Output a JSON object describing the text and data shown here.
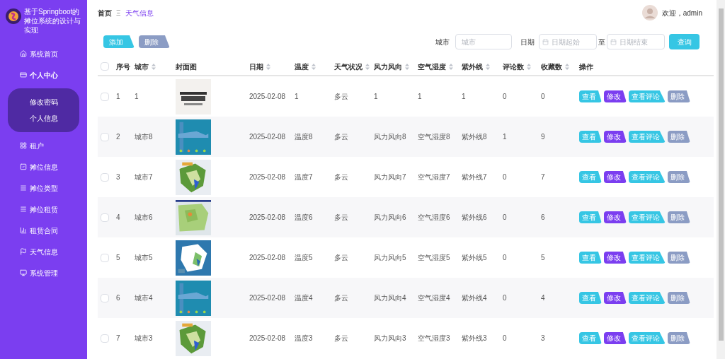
{
  "sidebar": {
    "title": "基于Springboot的摊位系统的设计与实现",
    "items": [
      {
        "label": "系统首页",
        "expanded": false
      },
      {
        "label": "个人中心",
        "expanded": true,
        "children": [
          {
            "label": "修改密码"
          },
          {
            "label": "个人信息"
          }
        ]
      },
      {
        "label": "租户",
        "expanded": false
      },
      {
        "label": "摊位信息",
        "expanded": false
      },
      {
        "label": "摊位类型",
        "expanded": false
      },
      {
        "label": "摊位租赁",
        "expanded": false
      },
      {
        "label": "租赁合同",
        "expanded": false
      },
      {
        "label": "天气信息",
        "expanded": false
      },
      {
        "label": "系统管理",
        "expanded": false
      }
    ]
  },
  "breadcrumb": {
    "home": "首页",
    "separator": "Ξ",
    "current": "天气信息"
  },
  "user": {
    "greeting": "欢迎，admin"
  },
  "toolbar": {
    "add": "添加",
    "delete": "删除"
  },
  "search": {
    "city_label": "城市",
    "city_placeholder": "城市",
    "date_label": "日期",
    "date_start_placeholder": "日期起始",
    "to": "至",
    "date_end_placeholder": "日期结束",
    "button": "查询"
  },
  "table": {
    "select_all_checked": false,
    "columns": [
      {
        "label": "序号",
        "sortable": false
      },
      {
        "label": "城市",
        "sortable": true
      },
      {
        "label": "封面图",
        "sortable": false
      },
      {
        "label": "日期",
        "sortable": true
      },
      {
        "label": "温度",
        "sortable": true
      },
      {
        "label": "天气状况",
        "sortable": true
      },
      {
        "label": "风力风向",
        "sortable": true
      },
      {
        "label": "空气湿度",
        "sortable": true
      },
      {
        "label": "紫外线",
        "sortable": true
      },
      {
        "label": "评论数",
        "sortable": true
      },
      {
        "label": "收藏数",
        "sortable": true
      },
      {
        "label": "操作",
        "sortable": false
      }
    ],
    "rows": [
      {
        "checked": false,
        "cells": [
          "1",
          "1",
          {
            "kind": "picture"
          },
          "2025-02-08",
          "1",
          "多云",
          "1",
          "1",
          "1",
          "0",
          "0"
        ],
        "actions": [
          "查看",
          "修改",
          "查看评论",
          "删除"
        ]
      },
      {
        "checked": false,
        "cells": [
          "2",
          "城市8",
          {
            "kind": "picture"
          },
          "2025-02-08",
          "温度8",
          "多云",
          "风力风向8",
          "空气湿度8",
          "紫外线8",
          "1",
          "9"
        ],
        "actions": [
          "查看",
          "修改",
          "查看评论",
          "删除"
        ]
      },
      {
        "checked": false,
        "cells": [
          "3",
          "城市7",
          {
            "kind": "picture"
          },
          "2025-02-08",
          "温度7",
          "多云",
          "风力风向7",
          "空气湿度7",
          "紫外线7",
          "0",
          "7"
        ],
        "actions": [
          "查看",
          "修改",
          "查看评论",
          "删除"
        ]
      },
      {
        "checked": false,
        "cells": [
          "4",
          "城市6",
          {
            "kind": "picture"
          },
          "2025-02-08",
          "温度6",
          "多云",
          "风力风向6",
          "空气湿度6",
          "紫外线6",
          "0",
          "6"
        ],
        "actions": [
          "查看",
          "修改",
          "查看评论",
          "删除"
        ]
      },
      {
        "checked": false,
        "cells": [
          "5",
          "城市5",
          {
            "kind": "picture"
          },
          "2025-02-08",
          "温度5",
          "多云",
          "风力风向5",
          "空气湿度5",
          "紫外线5",
          "0",
          "5"
        ],
        "actions": [
          "查看",
          "修改",
          "查看评论",
          "删除"
        ]
      },
      {
        "checked": false,
        "cells": [
          "6",
          "城市4",
          {
            "kind": "picture"
          },
          "2025-02-08",
          "温度4",
          "多云",
          "风力风向4",
          "空气湿度4",
          "紫外线4",
          "0",
          "4"
        ],
        "actions": [
          "查看",
          "修改",
          "查看评论",
          "删除"
        ]
      },
      {
        "checked": false,
        "cells": [
          "7",
          "城市3",
          {
            "kind": "picture"
          },
          "2025-02-08",
          "温度3",
          "多云",
          "风力风向3",
          "空气湿度3",
          "紫外线3",
          "0",
          "3"
        ],
        "actions": [
          "查看",
          "修改",
          "查看评论",
          "删除"
        ]
      }
    ]
  }
}
